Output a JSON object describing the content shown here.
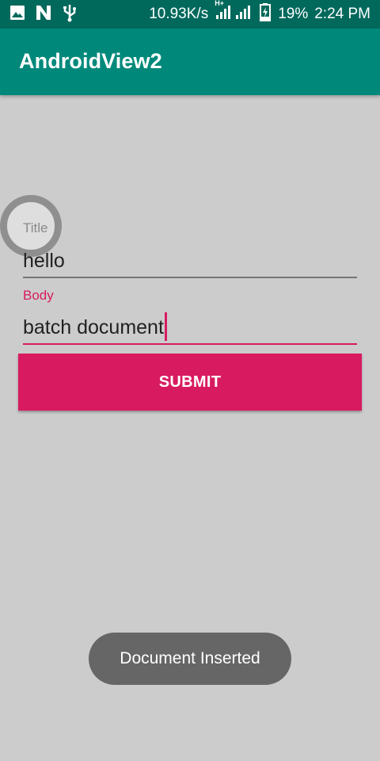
{
  "status_bar": {
    "network_speed": "10.93K/s",
    "network_type": "H+",
    "battery": "19%",
    "time": "2:24 PM",
    "icons": [
      "image-icon",
      "n-icon",
      "usb-icon",
      "signal-icon",
      "battery-icon"
    ]
  },
  "toolbar": {
    "title": "AndroidView2",
    "color": "#00897b"
  },
  "form": {
    "title_label": "Title",
    "title_value": "hello",
    "body_label": "Body",
    "body_value": "batch document",
    "submit_label": "SUBMIT",
    "accent_color": "#d81b60"
  },
  "toast": {
    "message": "Document Inserted"
  }
}
